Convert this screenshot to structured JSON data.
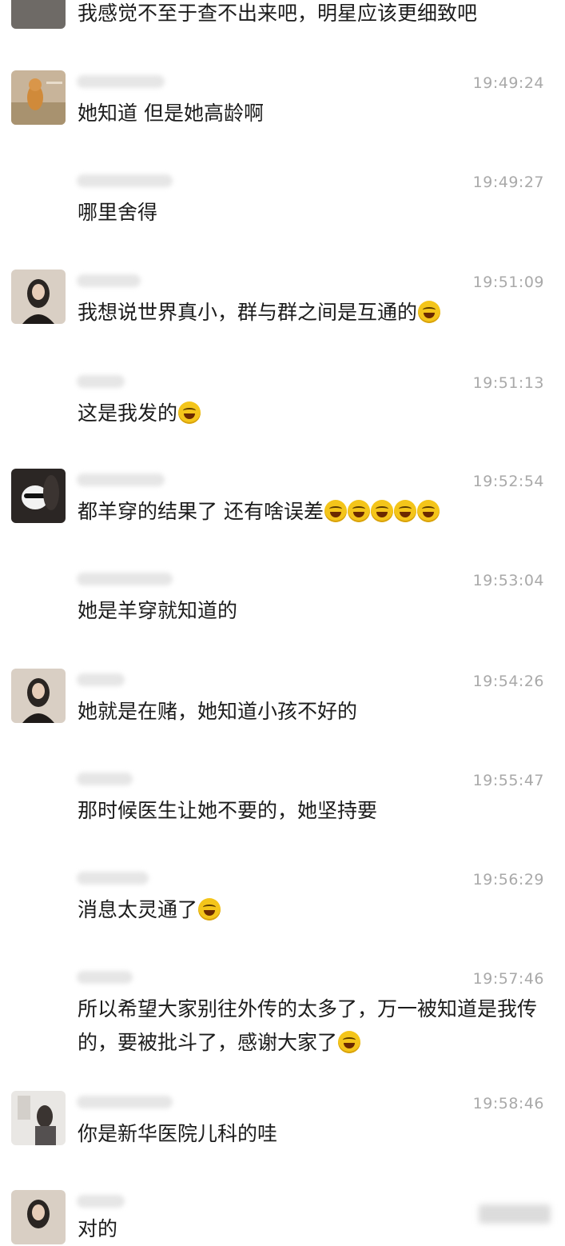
{
  "messages": [
    {
      "time": "",
      "text": "我感觉不至于查不出来吧，明星应该更细致吧",
      "avatar": "avatar-dark",
      "emoji": 0
    },
    {
      "time": "19:49:24",
      "text": "她知道 但是她高龄啊",
      "avatar": "avatar-cat",
      "emoji": 0
    },
    {
      "time": "19:49:27",
      "text": "哪里舍得",
      "avatar": "none",
      "emoji": 0
    },
    {
      "time": "19:51:09",
      "text": "我想说世界真小，群与群之间是互通的",
      "avatar": "avatar-girl",
      "emoji": 1
    },
    {
      "time": "19:51:13",
      "text": "这是我发的",
      "avatar": "none",
      "emoji": 1
    },
    {
      "time": "19:52:54",
      "text": "都羊穿的结果了 还有啥误差",
      "avatar": "avatar-dog",
      "emoji": 5
    },
    {
      "time": "19:53:04",
      "text": "她是羊穿就知道的",
      "avatar": "none",
      "emoji": 0
    },
    {
      "time": "19:54:26",
      "text": "她就是在赌，她知道小孩不好的",
      "avatar": "avatar-girl",
      "emoji": 0
    },
    {
      "time": "19:55:47",
      "text": "那时候医生让她不要的，她坚持要",
      "avatar": "none",
      "emoji": 0
    },
    {
      "time": "19:56:29",
      "text": "消息太灵通了",
      "avatar": "none",
      "emoji": 1
    },
    {
      "time": "19:57:46",
      "text": "所以希望大家别往外传的太多了，万一被知道是我传的，要被批斗了，感谢大家了",
      "avatar": "none",
      "emoji": 1
    },
    {
      "time": "19:58:46",
      "text": "你是新华医院儿科的哇",
      "avatar": "avatar-room",
      "emoji": 0
    },
    {
      "time": "",
      "text": "对的",
      "avatar": "avatar-girl",
      "emoji": 0
    }
  ],
  "colors": {
    "time": "#a9a9a9",
    "text": "#1c1c1c",
    "background": "#ffffff",
    "emoji": "#f4c51a"
  },
  "icons": [
    "laughing-emoji-icon"
  ]
}
